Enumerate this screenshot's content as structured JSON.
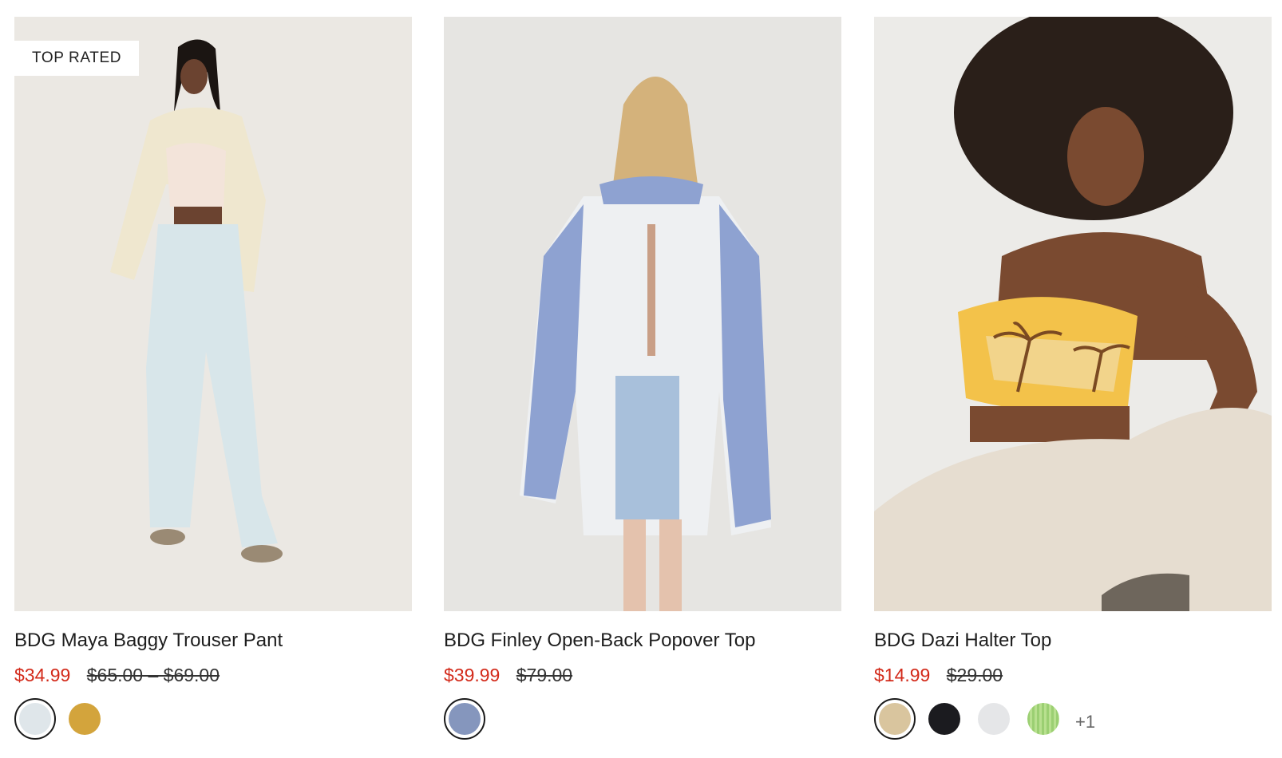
{
  "products": [
    {
      "badge": "TOP RATED",
      "title": "BDG Maya Baggy Trouser Pant",
      "sale_price": "$34.99",
      "original_price": "$65.00 – $69.00",
      "swatches": [
        "#dfe6ea",
        "#d3a43c"
      ],
      "selected_swatch": 0
    },
    {
      "badge": "",
      "title": "BDG Finley Open-Back Popover Top",
      "sale_price": "$39.99",
      "original_price": "$79.00",
      "swatches": [
        "#8596bd"
      ],
      "selected_swatch": 0
    },
    {
      "badge": "",
      "title": "BDG Dazi Halter Top",
      "sale_price": "$14.99",
      "original_price": "$29.00",
      "swatches": [
        "#d9c59e",
        "#1b1b1f",
        "#e5e6e8",
        "#9bcf72"
      ],
      "selected_swatch": 0,
      "more_colors": "+1"
    }
  ],
  "colors": {
    "sale_red": "#d32a1a",
    "image_bg_1": "#ebe8e3",
    "image_bg_2": "#e6e5e2",
    "image_bg_3": "#ecebe8"
  }
}
